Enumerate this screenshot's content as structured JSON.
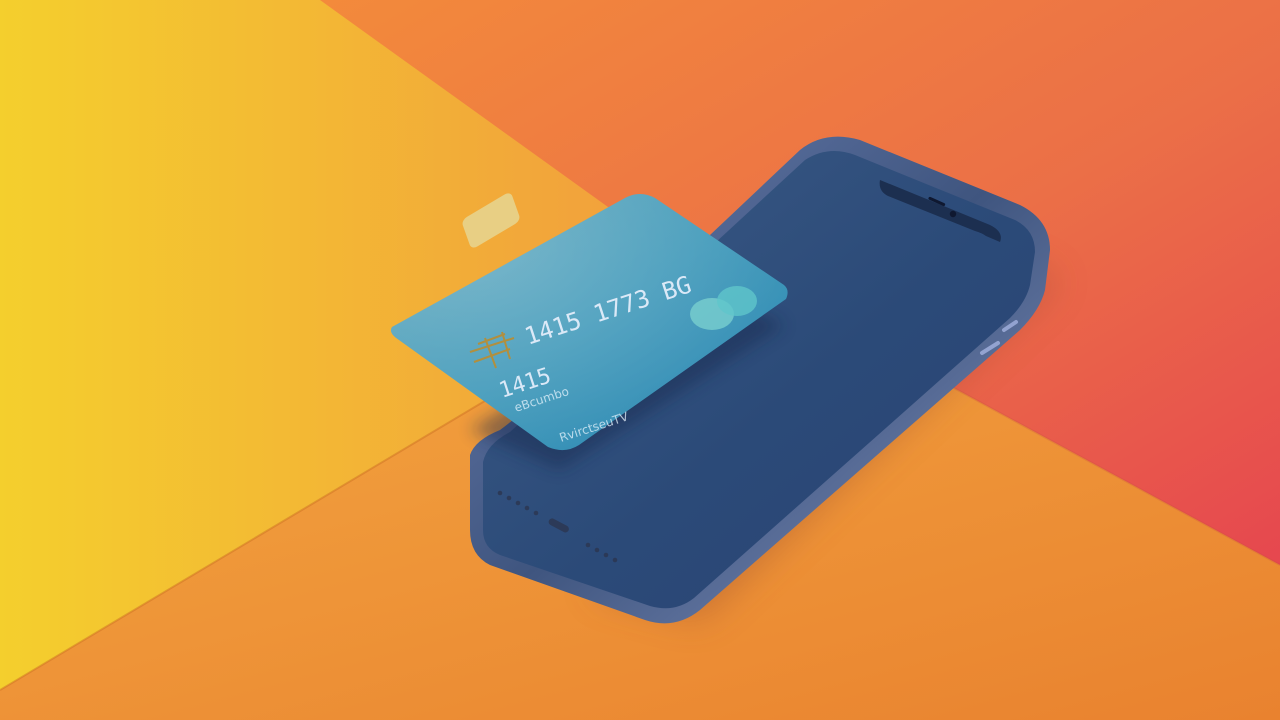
{
  "scene": {
    "description_label": "",
    "colors": {
      "background_left": "#f2c72f",
      "background_center": "#f08d36",
      "background_right": "#e74f4f",
      "phone_screen": "#2f4f7f",
      "phone_frame": "#5b6f9a",
      "card_start": "#2a8fb0",
      "card_end": "#4aa0bf",
      "chip": "#e6c97a"
    }
  },
  "card": {
    "number": "1415 1773 BG",
    "line_1": "1415",
    "line_2": "eBcumbo",
    "line_3": "RvirctseuTV"
  },
  "icons": {
    "logo": "mastercard-like-circles-icon",
    "chip": "card-chip-icon",
    "camera": "front-camera-icon"
  }
}
